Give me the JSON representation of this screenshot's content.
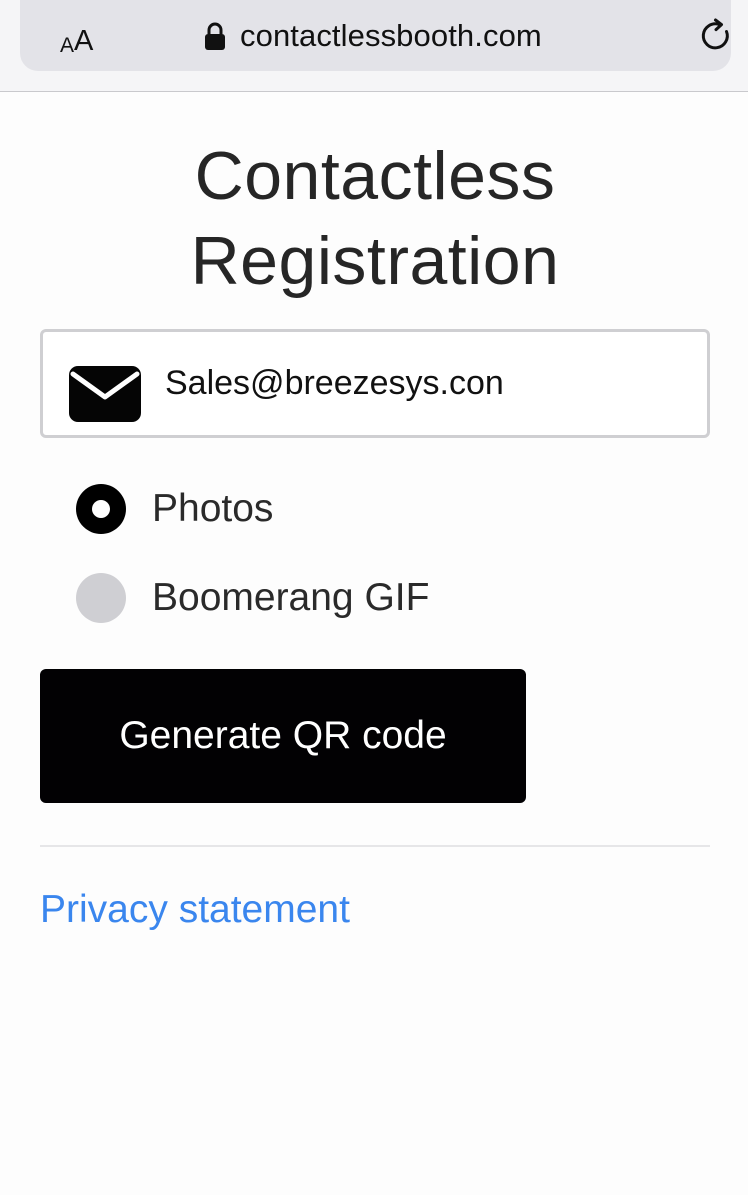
{
  "browser": {
    "text_size_small": "A",
    "text_size_large": "A",
    "url": "contactlessbooth.com",
    "icons": {
      "lock": "lock-icon",
      "reload": "reload-icon"
    }
  },
  "page": {
    "title_line1": "Contactless",
    "title_line2": "Registration"
  },
  "email": {
    "value": "Sales@breezesys.con",
    "icon": "envelope-icon"
  },
  "output_type": {
    "options": [
      {
        "label": "Photos",
        "checked": true
      },
      {
        "label": "Boomerang GIF",
        "checked": false
      }
    ]
  },
  "actions": {
    "generate_label": "Generate QR code"
  },
  "footer": {
    "privacy_label": "Privacy statement"
  },
  "colors": {
    "link": "#3a86ee",
    "button_background": "#020103",
    "button_text": "#ffffff"
  }
}
